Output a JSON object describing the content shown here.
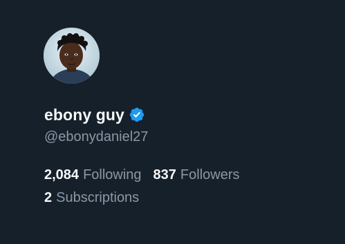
{
  "profile": {
    "display_name": "ebony guy",
    "handle": "@ebonydaniel27",
    "verified": true,
    "verified_color": "#1d9bf0"
  },
  "stats": {
    "following_count": "2,084",
    "following_label": "Following",
    "followers_count": "837",
    "followers_label": "Followers",
    "subscriptions_count": "2",
    "subscriptions_label": "Subscriptions"
  },
  "theme": {
    "background": "#15202b",
    "primary_text": "#f7f9f9",
    "secondary_text": "#8b98a5"
  },
  "icons": {
    "avatar": "avatar-photo",
    "verified": "verified-badge-icon"
  }
}
